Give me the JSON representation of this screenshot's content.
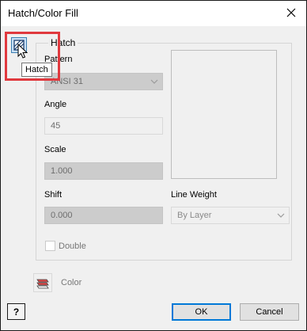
{
  "dialog": {
    "title": "Hatch/Color Fill"
  },
  "hatch_group": {
    "legend": "Hatch",
    "tooltip": "Hatch",
    "pattern_label": "Pattern",
    "pattern_value": "ANSI 31",
    "angle_label": "Angle",
    "angle_value": "45",
    "scale_label": "Scale",
    "scale_value": "1.000",
    "shift_label": "Shift",
    "shift_value": "0.000",
    "line_weight_label": "Line Weight",
    "line_weight_value": "By Layer",
    "double_label": "Double",
    "double_checked": false
  },
  "color": {
    "label": "Color",
    "icon": "hatch-swatch-icon"
  },
  "footer": {
    "help_label": "?",
    "ok_label": "OK",
    "cancel_label": "Cancel"
  },
  "icons": [
    "close-icon",
    "hatch-icon",
    "mouse-cursor-icon",
    "chevron-down-icon",
    "hatch-swatch-icon",
    "help-icon"
  ],
  "colors": {
    "highlight": "#e0393e",
    "ok_border": "#0078d7",
    "icon_active_bg": "#c9e0f7"
  }
}
